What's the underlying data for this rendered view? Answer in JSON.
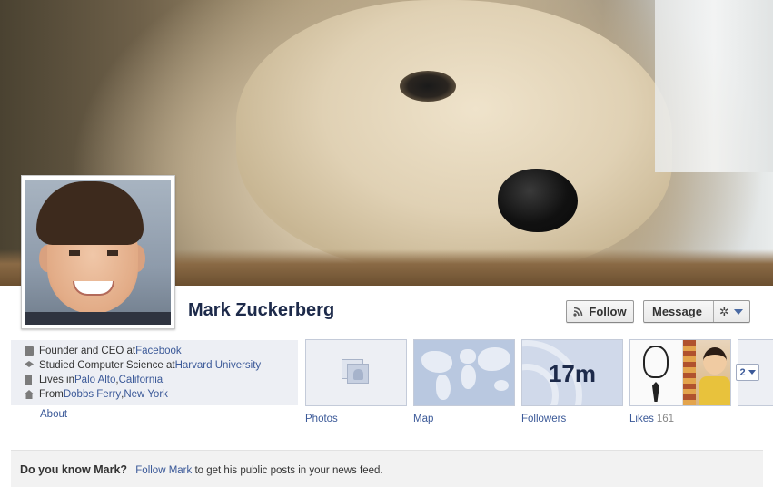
{
  "profile": {
    "name": "Mark Zuckerberg"
  },
  "actions": {
    "follow_label": "Follow",
    "message_label": "Message"
  },
  "about": {
    "rows": [
      {
        "prefix": "Founder and CEO at ",
        "link": "Facebook",
        "mid": "",
        "link2": ""
      },
      {
        "prefix": "Studied Computer Science at ",
        "link": "Harvard University",
        "mid": "",
        "link2": ""
      },
      {
        "prefix": "Lives in ",
        "link": "Palo Alto",
        "mid": ", ",
        "link2": "California"
      },
      {
        "prefix": "From ",
        "link": "Dobbs Ferry",
        "mid": ", ",
        "link2": "New York"
      }
    ],
    "about_link": "About"
  },
  "tiles": {
    "photos_label": "Photos",
    "map_label": "Map",
    "followers_label": "Followers",
    "followers_count": "17m",
    "likes_label": "Likes",
    "likes_count": "161",
    "more_count": "2"
  },
  "prompt": {
    "question": "Do you know Mark?",
    "link": "Follow Mark",
    "rest": " to get his public posts in your news feed."
  },
  "colors": {
    "link": "#3b5998",
    "name": "#1d2a4a",
    "panel": "#edeff4"
  },
  "icons": [
    "rss-icon",
    "gear-icon",
    "chevron-down-icon",
    "briefcase-icon",
    "graduation-cap-icon",
    "building-icon",
    "house-icon",
    "photos-icon"
  ]
}
